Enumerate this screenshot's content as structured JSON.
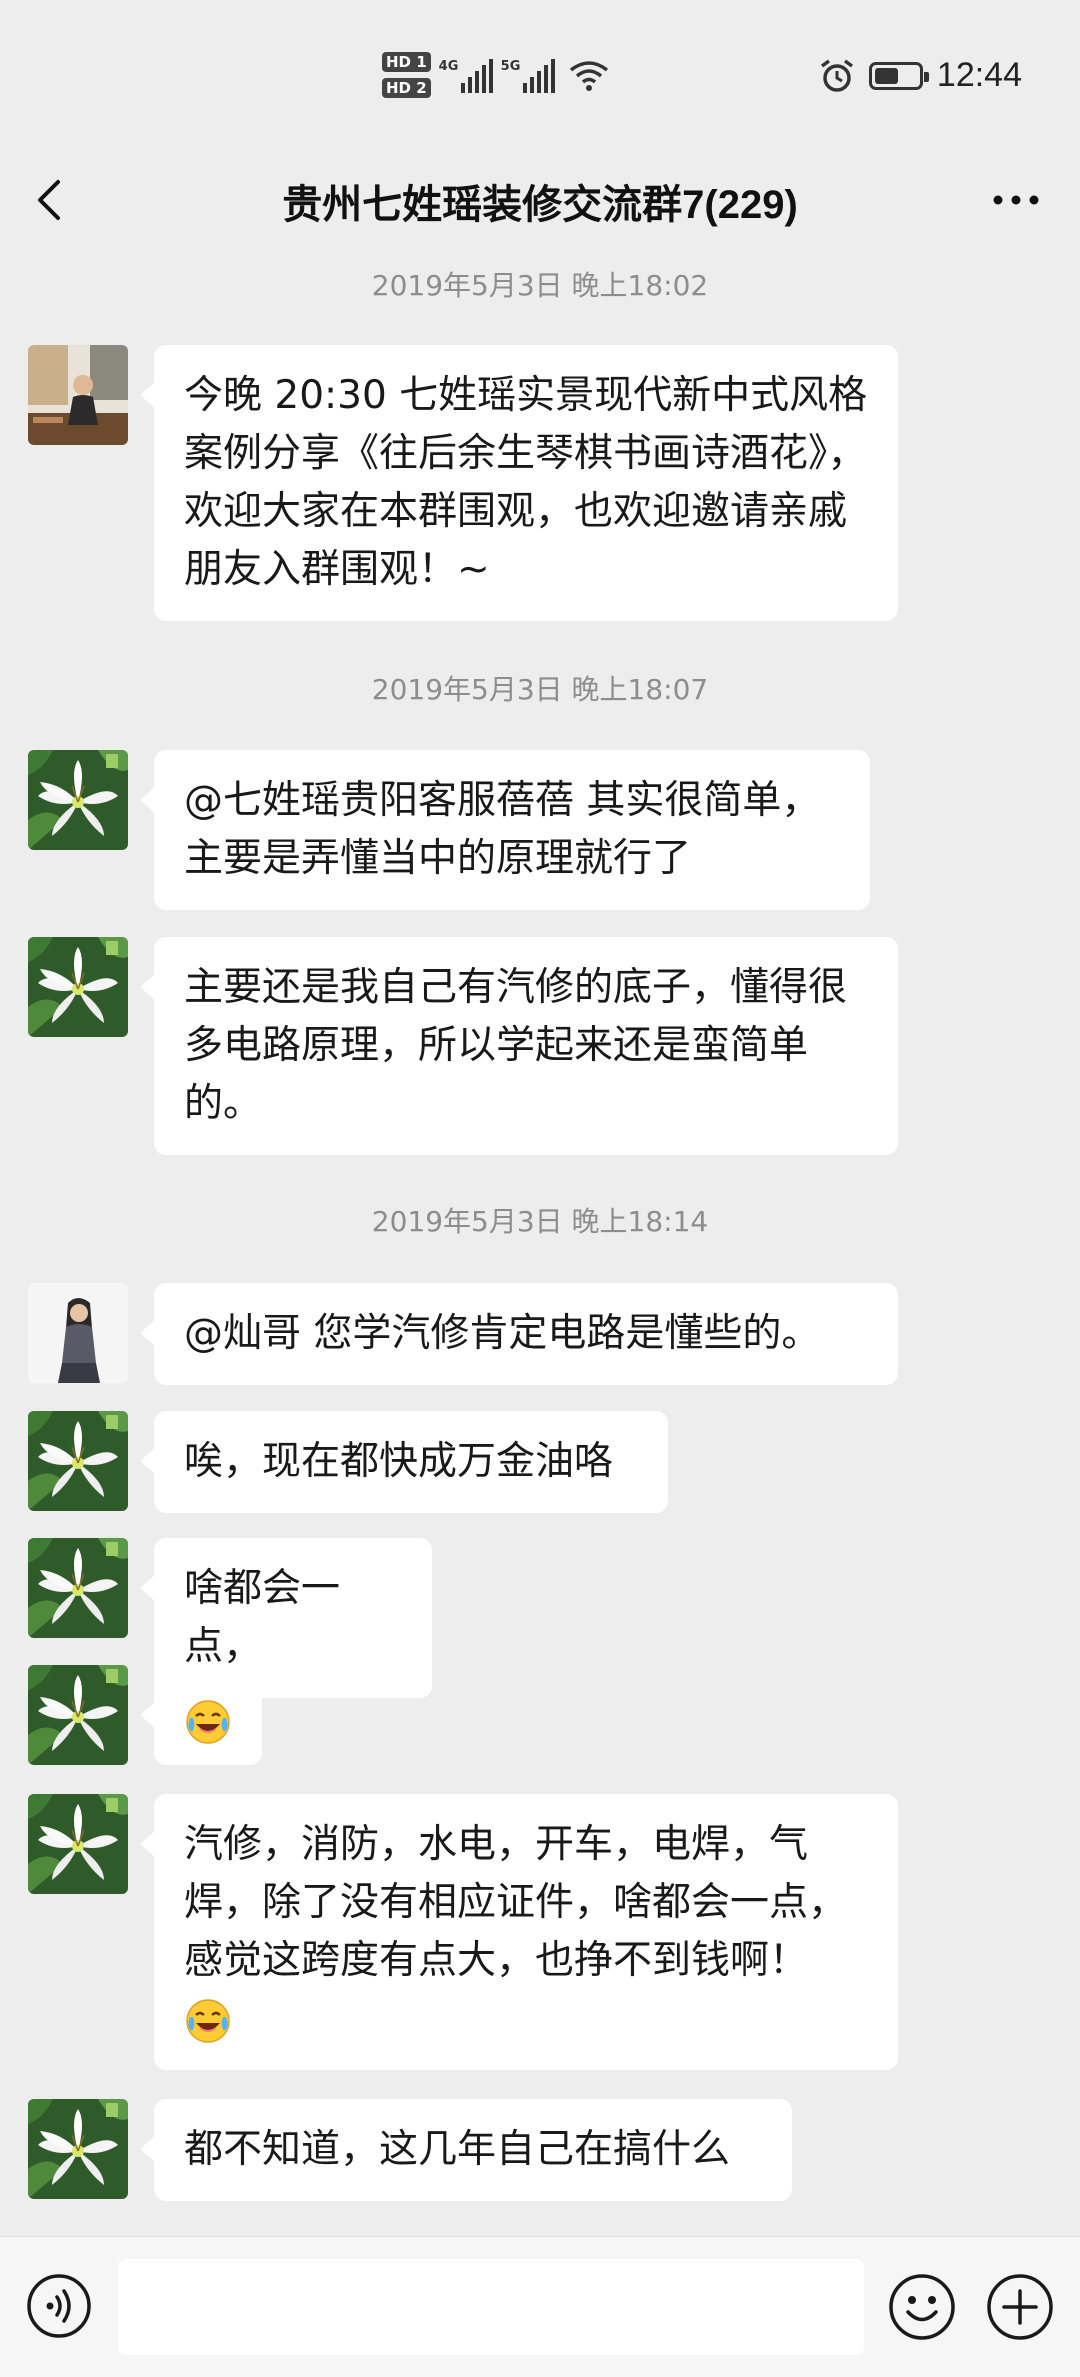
{
  "status_bar": {
    "hd1": "HD 1",
    "hd2": "HD 2",
    "sim1": "4G",
    "sim2": "5G",
    "time": "12:44",
    "battery_level": 0.55,
    "icons": [
      "signal-4g-icon",
      "signal-5g-icon",
      "wifi-icon",
      "alarm-icon",
      "battery-icon"
    ]
  },
  "header": {
    "title": "贵州七姓瑶装修交流群7(229)",
    "back_icon": "chevron-left-icon",
    "more_icon": "more-dots-icon"
  },
  "messages": [
    {
      "type": "timestamp",
      "text": "2019年5月3日 晚上18:02"
    },
    {
      "type": "message",
      "avatar": "person-avatar",
      "text": "今晚 20:30 七姓瑶实景现代新中式风格案例分享《往后余生琴棋书画诗酒花》，欢迎大家在本群围观，也欢迎邀请亲戚朋友入群围观！~"
    },
    {
      "type": "timestamp",
      "text": "2019年5月3日 晚上18:07"
    },
    {
      "type": "message",
      "avatar": "lily-avatar",
      "text": "@七姓瑶贵阳客服蓓蓓  其实很简单，主要是弄懂当中的原理就行了"
    },
    {
      "type": "message",
      "avatar": "lily-avatar",
      "text": "主要还是我自己有汽修的底子，懂得很多电路原理，所以学起来还是蛮简单的。"
    },
    {
      "type": "timestamp",
      "text": "2019年5月3日 晚上18:14"
    },
    {
      "type": "message",
      "avatar": "woman-avatar",
      "text": "@灿哥  您学汽修肯定电路是懂些的。"
    },
    {
      "type": "message",
      "avatar": "lily-avatar",
      "text": "唉，现在都快成万金油咯"
    },
    {
      "type": "message",
      "avatar": "lily-avatar",
      "text": "啥都会一点，"
    },
    {
      "type": "message",
      "avatar": "lily-avatar",
      "emoji": "laugh-cry-emoji"
    },
    {
      "type": "message",
      "avatar": "lily-avatar",
      "text": "汽修，消防，水电，开车，电焊，气焊，除了没有相应证件，啥都会一点，感觉这跨度有点大，也挣不到钱啊！",
      "emoji": "laugh-cry-emoji"
    },
    {
      "type": "message",
      "avatar": "lily-avatar",
      "text": "都不知道，这几年自己在搞什么"
    }
  ],
  "input_bar": {
    "placeholder": "",
    "voice_icon": "voice-icon",
    "emoji_icon": "emoji-icon",
    "plus_icon": "plus-icon"
  }
}
